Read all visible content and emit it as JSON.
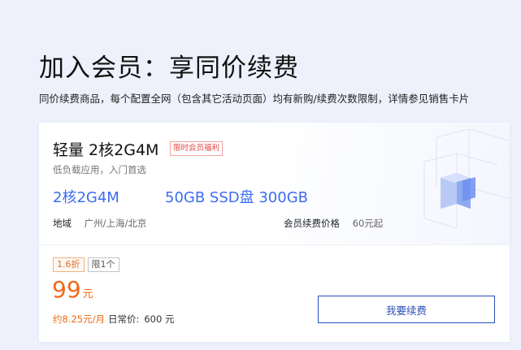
{
  "header": {
    "title": "加入会员：享同价续费",
    "subtitle": "同价续费商品，每个配置全网（包含其它活动页面）均有新购/续费次数限制，详情参见销售卡片"
  },
  "card": {
    "plan_name": "轻量 2核2G4M",
    "limited_tag": "限时会员福利",
    "description": "低负载应用，入门首选",
    "spec_cpu": "2核2G4M",
    "spec_disk": "50GB SSD盘 300GB",
    "region_label": "地域",
    "region_value": "广州/上海/北京",
    "member_price_label": "会员续费价格",
    "member_price_value": "60元起",
    "discount_badge": "1.6折",
    "limit_badge": "限1个",
    "price": "99",
    "price_unit": "元",
    "monthly": "约8.25元/月",
    "daily_label": "日常价:",
    "original_price": "600 元",
    "renew_button": "我要续费"
  },
  "colors": {
    "accent_blue": "#3d6cf0",
    "price_orange": "#f06a19",
    "button_border": "#2b50b8"
  }
}
